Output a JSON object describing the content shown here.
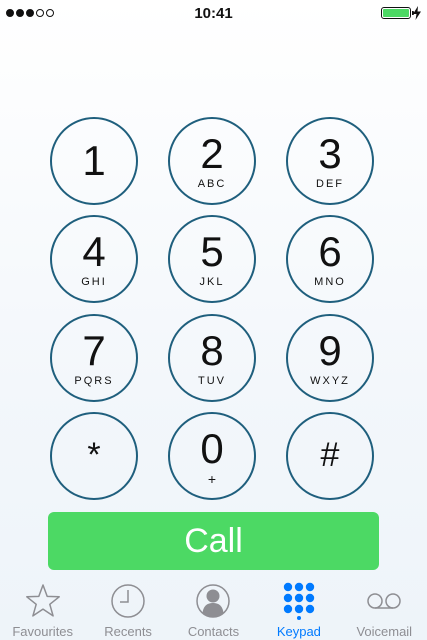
{
  "status_bar": {
    "time": "10:41",
    "signal_bars_filled": 3,
    "signal_bars_total": 5,
    "battery_level": 1.0,
    "battery_color": "#4cd964"
  },
  "keypad": {
    "keys": [
      {
        "digit": "1",
        "letters": ""
      },
      {
        "digit": "2",
        "letters": "ABC"
      },
      {
        "digit": "3",
        "letters": "DEF"
      },
      {
        "digit": "4",
        "letters": "GHI"
      },
      {
        "digit": "5",
        "letters": "JKL"
      },
      {
        "digit": "6",
        "letters": "MNO"
      },
      {
        "digit": "7",
        "letters": "PQRS"
      },
      {
        "digit": "8",
        "letters": "TUV"
      },
      {
        "digit": "9",
        "letters": "WXYZ"
      },
      {
        "digit": "*",
        "letters": ""
      },
      {
        "digit": "0",
        "letters": "+"
      },
      {
        "digit": "#",
        "letters": ""
      }
    ]
  },
  "call_button": {
    "label": "Call",
    "color": "#4cd964"
  },
  "tab_bar": {
    "tabs": [
      {
        "label": "Favourites",
        "icon": "star-icon",
        "active": false
      },
      {
        "label": "Recents",
        "icon": "clock-icon",
        "active": false
      },
      {
        "label": "Contacts",
        "icon": "contact-icon",
        "active": false
      },
      {
        "label": "Keypad",
        "icon": "keypad-icon",
        "active": true
      },
      {
        "label": "Voicemail",
        "icon": "voicemail-icon",
        "active": false
      }
    ],
    "active_color": "#007aff",
    "inactive_color": "#8e8e93"
  }
}
